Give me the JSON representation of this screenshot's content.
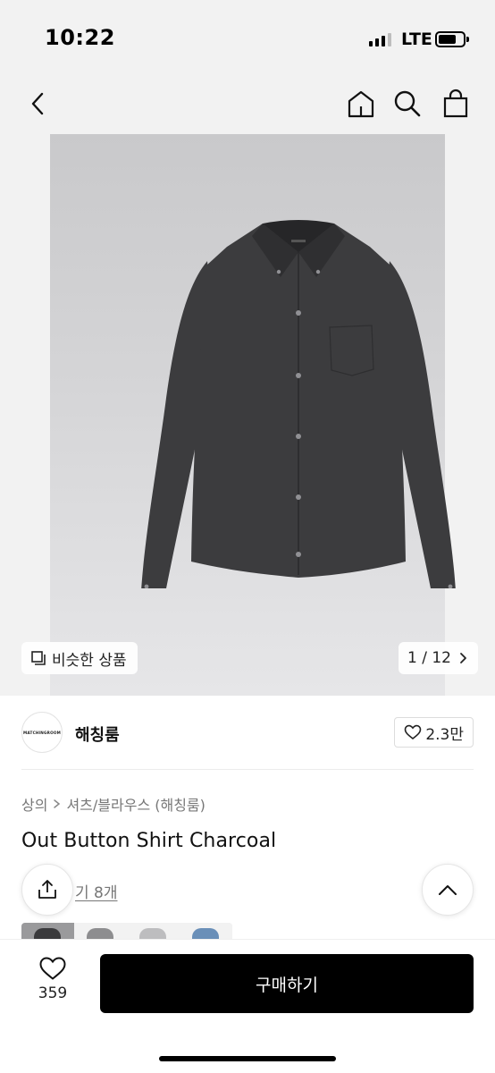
{
  "status_bar": {
    "time": "10:22",
    "network": "LTE",
    "battery_level": 0.72
  },
  "nav": {
    "icons": [
      "back-icon",
      "home-icon",
      "search-icon",
      "shopping-bag-icon"
    ]
  },
  "gallery": {
    "similar_label": "비슷한 상품",
    "counter": "1 / 12",
    "background_color": "#d5d5d7",
    "shirt_color": "#3c3c3e"
  },
  "brand": {
    "logo_text": "MATCHINGROOM",
    "name": "해칭룸",
    "likes": "2.3만"
  },
  "breadcrumb": {
    "level1": "상의",
    "level2": "셔츠/블라우스 (해칭룸)"
  },
  "product": {
    "title": "Out Button Shirt Charcoal",
    "review_link": "기 8개"
  },
  "thumbnails": {
    "colors": [
      "#3a3a3c",
      "#8d8d8f",
      "#bdbdbf",
      "#6a8fb8"
    ]
  },
  "bottom_bar": {
    "wish_count": "359",
    "buy_label": "구매하기"
  }
}
